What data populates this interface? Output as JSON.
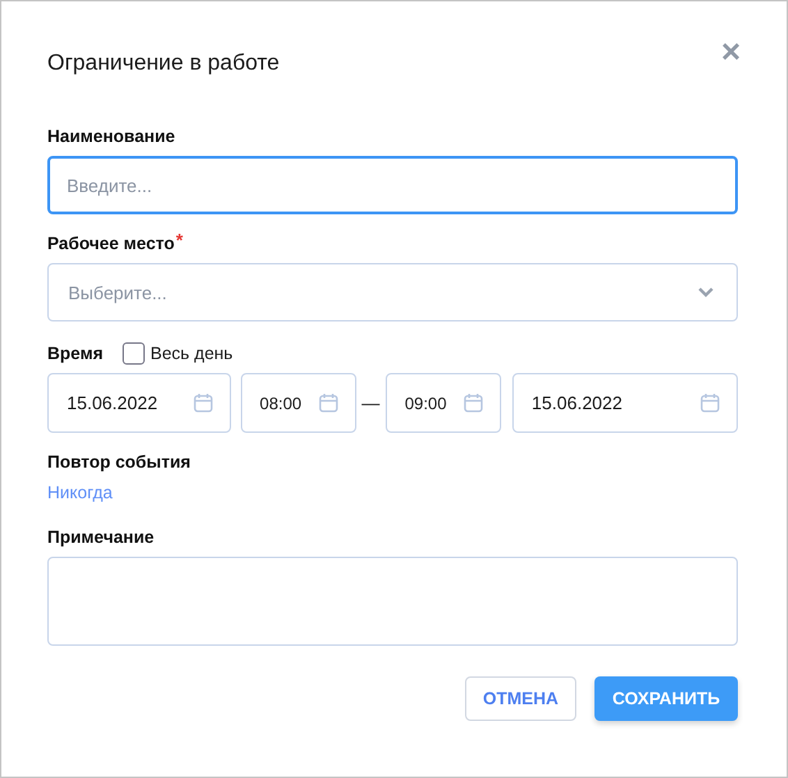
{
  "dialog": {
    "title": "Ограничение в работе",
    "close": "×"
  },
  "name_field": {
    "label": "Наименование",
    "placeholder": "Введите...",
    "focused": true
  },
  "workplace_field": {
    "label": "Рабочее место",
    "required": "*",
    "placeholder": "Выберите..."
  },
  "time": {
    "label": "Время",
    "all_day": {
      "label": "Весь день",
      "checked": false
    },
    "start_date": "15.06.2022",
    "start_time": "08:00",
    "separator": "—",
    "end_time": "09:00",
    "end_date": "15.06.2022"
  },
  "repeat": {
    "label": "Повтор события",
    "value": "Никогда"
  },
  "note_field": {
    "label": "Примечание"
  },
  "buttons": [
    {
      "label": "ОТМЕНА",
      "kind": "secondary"
    },
    {
      "label": "СОХРАНИТЬ",
      "kind": "primary"
    }
  ]
}
